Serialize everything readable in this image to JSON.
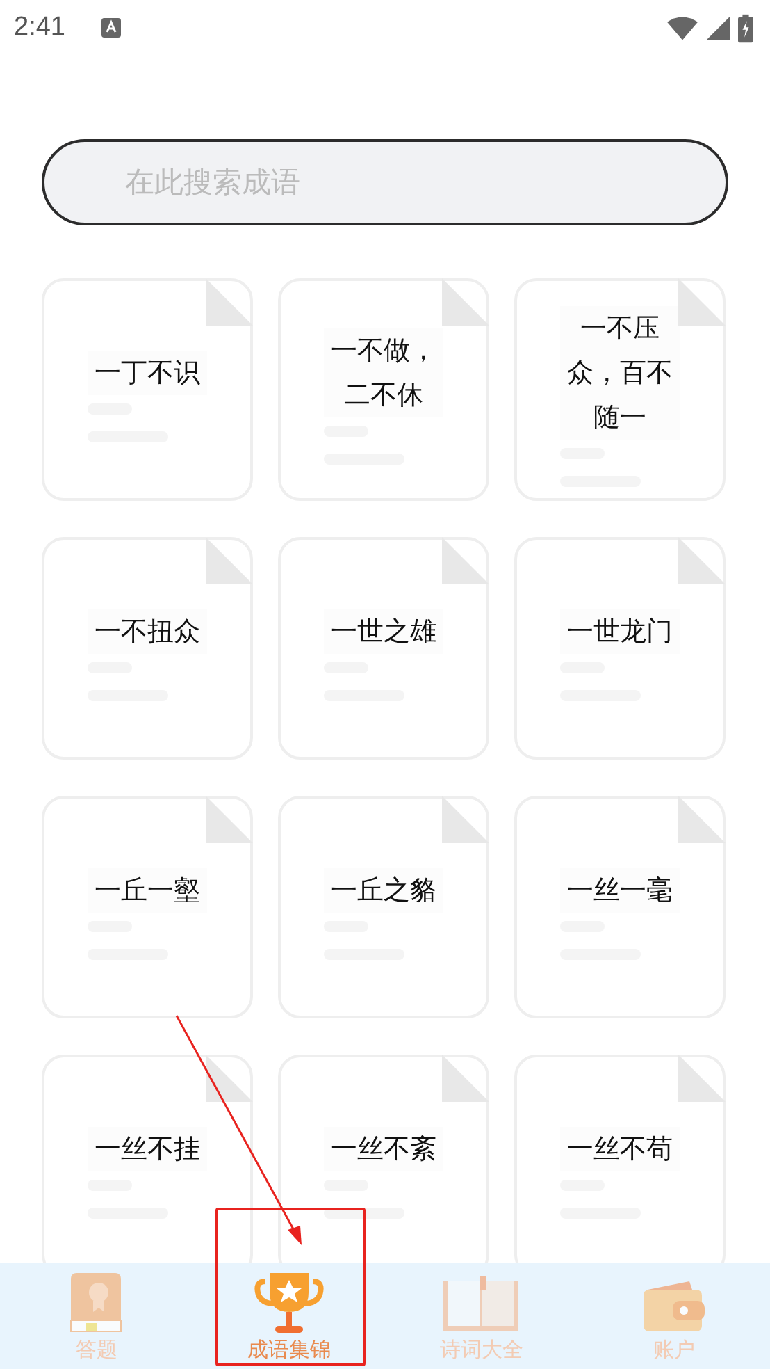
{
  "status_bar": {
    "time": "2:41"
  },
  "search": {
    "placeholder": "在此搜索成语"
  },
  "idioms": [
    {
      "text": "一丁不识"
    },
    {
      "text": "一不做，二不休"
    },
    {
      "text": "一不压众，百不随一"
    },
    {
      "text": "一不扭众"
    },
    {
      "text": "一世之雄"
    },
    {
      "text": "一世龙门"
    },
    {
      "text": "一丘一壑"
    },
    {
      "text": "一丘之貉"
    },
    {
      "text": "一丝一毫"
    },
    {
      "text": "一丝不挂"
    },
    {
      "text": "一丝不紊"
    },
    {
      "text": "一丝不苟"
    }
  ],
  "nav": [
    {
      "label": "答题",
      "kind": "book",
      "selected": false,
      "highlighted": false
    },
    {
      "label": "成语集锦",
      "kind": "trophy",
      "selected": true,
      "highlighted": true
    },
    {
      "label": "诗词大全",
      "kind": "open-book",
      "selected": false,
      "highlighted": false
    },
    {
      "label": "账户",
      "kind": "wallet",
      "selected": false,
      "highlighted": false
    }
  ]
}
